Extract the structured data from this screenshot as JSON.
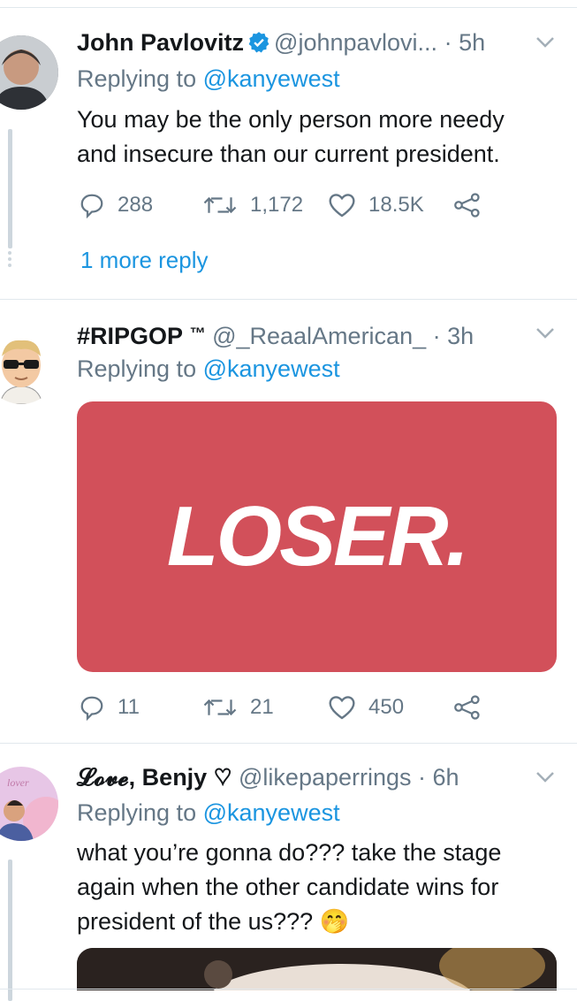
{
  "tweets": [
    {
      "name": "John Pavlovitz",
      "verified": true,
      "handle": "@johnpavlovi...",
      "time": "· 5h",
      "reply_label": "Replying to",
      "reply_mention": "@kanyewest",
      "text_lines": [
        "You may be the only person more needy",
        "and insecure than our current president."
      ],
      "replies": "288",
      "retweets": "1,172",
      "likes": "18.5K",
      "more_reply": "1 more reply"
    },
    {
      "name": "#RIPGOP",
      "name_suffix": "™",
      "handle": "@_ReaalAmerican_",
      "time": "· 3h",
      "reply_label": "Replying to",
      "reply_mention": "@kanyewest",
      "media_text": "LOSER.",
      "replies": "11",
      "retweets": "21",
      "likes": "450"
    },
    {
      "name": "𝓛𝓸𝓿𝓮, Benjy ♡",
      "handle": "@likepaperrings",
      "time": "· 6h",
      "reply_label": "Replying to",
      "reply_mention": "@kanyewest",
      "text_lines": [
        "what you’re gonna do??? take the stage",
        "again when the other candidate wins for",
        "president of the us??? 🤭"
      ]
    }
  ],
  "colors": {
    "accent": "#1b95e0",
    "secondary_text": "#657786",
    "media_red": "#d2505a",
    "divider": "#e1e8ed"
  }
}
